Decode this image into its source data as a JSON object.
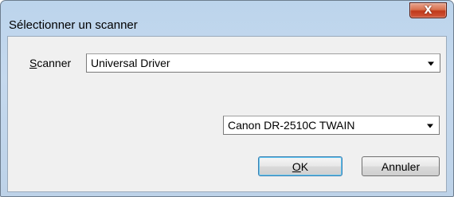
{
  "window": {
    "title": "Sélectionner un scanner",
    "close_glyph": "X"
  },
  "scanner": {
    "label_mnemonic": "S",
    "label_rest": "canner",
    "driver_value": "Universal Driver",
    "model_value": "Canon DR-2510C TWAIN"
  },
  "buttons": {
    "ok_mnemonic": "O",
    "ok_rest": "K",
    "cancel_label": "Annuler"
  },
  "colors": {
    "close_button": "#c0391b",
    "ok_focus": "#3c7fb1"
  }
}
